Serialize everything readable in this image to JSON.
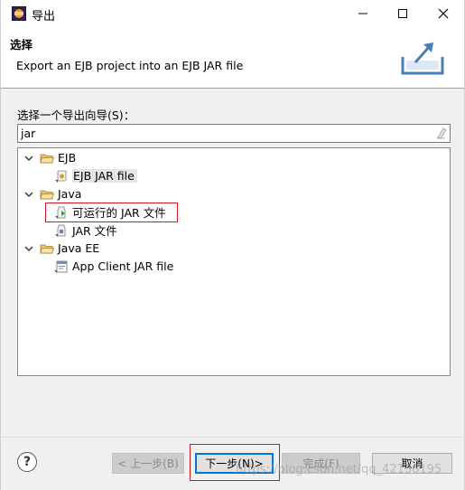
{
  "window": {
    "title": "导出",
    "app_icon": "eclipse-icon",
    "controls": [
      "minimize-icon",
      "maximize-icon",
      "close-icon"
    ]
  },
  "header": {
    "title": "选择",
    "description": "Export an EJB project into an EJB JAR file",
    "graphic": "export-wizard-graphic"
  },
  "wizard": {
    "label": "选择一个导出向导(S)：",
    "filter_value": "jar",
    "clear_icon": "clear-filter-icon"
  },
  "tree": [
    {
      "label": "EJB",
      "icon": "folder-open-icon",
      "expanded": true,
      "children": [
        {
          "label": "EJB JAR file",
          "icon": "ejb-jar-icon",
          "selected": true
        }
      ]
    },
    {
      "label": "Java",
      "icon": "folder-open-icon",
      "expanded": true,
      "children": [
        {
          "label": "可运行的 JAR 文件",
          "icon": "runnable-jar-icon",
          "highlighted": true
        },
        {
          "label": "JAR 文件",
          "icon": "jar-icon"
        }
      ]
    },
    {
      "label": "Java EE",
      "icon": "folder-open-icon",
      "expanded": true,
      "children": [
        {
          "label": "App Client JAR file",
          "icon": "app-client-jar-icon"
        }
      ]
    }
  ],
  "buttons": {
    "help": "?",
    "back": "< 上一步(B)",
    "next": "下一步(N)>",
    "finish": "完成(F)",
    "cancel": "取消"
  },
  "watermark": "https://blog.csdn.net/qq_42136195",
  "colors": {
    "highlight_box": "#d0191f",
    "default_button_border": "#0078d7"
  }
}
